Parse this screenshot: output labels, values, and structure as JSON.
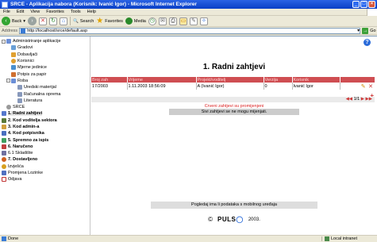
{
  "window": {
    "title": "SRCE - Aplikacija nabora (Korisnik: Ivanić Igor) - Microsoft Internet Explorer",
    "controls": {
      "minimize": "_",
      "maximize": "□",
      "close": "✕"
    }
  },
  "menu": [
    "File",
    "Edit",
    "View",
    "Favorites",
    "Tools",
    "Help"
  ],
  "toolbar": {
    "back": "Back",
    "search": "Search",
    "favorites": "Favorites",
    "media": "Media"
  },
  "address": {
    "label": "Address",
    "url": "http://localhost/srce/default.asp",
    "go": "Go"
  },
  "tree": [
    {
      "label": "Administriranje aplikacije",
      "level": 0,
      "expander": "−",
      "icon_color": "#6b8ed6"
    },
    {
      "label": "Gradovi",
      "level": 1,
      "icon_color": "#6aa0d8"
    },
    {
      "label": "Dobavljači",
      "level": 1,
      "icon_color": "#e0a030"
    },
    {
      "label": "Korisnici",
      "level": 1,
      "icon_color": "#e0a030"
    },
    {
      "label": "Mjerne jedinice",
      "level": 1,
      "icon_color": "#4a90d0"
    },
    {
      "label": "Potpis za papir",
      "level": 1,
      "icon_color": "#d07030"
    },
    {
      "label": "Roba",
      "level": 1,
      "expander": "−",
      "icon_color": "#6b8ed6"
    },
    {
      "label": "Uredski materijal",
      "level": 2,
      "icon_color": "#8899bb"
    },
    {
      "label": "Računalna oprema",
      "level": 2,
      "icon_color": "#8899bb"
    },
    {
      "label": "Literatura",
      "level": 2,
      "icon_color": "#8899bb"
    },
    {
      "label": "SRCE",
      "level": 0,
      "icon_color": "#999999"
    },
    {
      "label": "1. Radni zahtjevi",
      "level": 0,
      "bold": true,
      "selected": true,
      "icon_color": "#5577cc"
    },
    {
      "label": "2. Kod voditelja sektora",
      "level": 0,
      "bold": true,
      "icon_color": "#5a7a3a"
    },
    {
      "label": "3. Kod admin-a",
      "level": 0,
      "bold": true,
      "icon_color": "#d0a040"
    },
    {
      "label": "4. Kod potpisnika",
      "level": 0,
      "bold": true,
      "icon_color": "#4a70c0"
    },
    {
      "label": "5. Spremno za ispis",
      "level": 0,
      "bold": true,
      "icon_color": "#40a060"
    },
    {
      "label": "6. Naručeno",
      "level": 0,
      "bold": true,
      "icon_color": "#c04040"
    },
    {
      "label": "6.1 Skladište",
      "level": 0,
      "icon_color": "#7070a0"
    },
    {
      "label": "7. Dostavljeno",
      "level": 0,
      "bold": true,
      "icon_color": "#d06020"
    },
    {
      "label": "Izvješća",
      "level": 0,
      "icon_color": "#d8a020"
    },
    {
      "label": "Promjena Lozinke",
      "level": 0,
      "icon_color": "#5070c0"
    },
    {
      "label": "Odjava",
      "level": 0,
      "icon_color": "#c03030"
    }
  ],
  "main": {
    "help_icon": "?",
    "title": "1. Radni zahtjevi",
    "table": {
      "columns": [
        "Broj zah",
        "Vrijeme",
        "Projekt/voditelj",
        "Verzija",
        "Korisnik"
      ],
      "rows": [
        [
          "17/2003",
          "1.11.2003 18:56:09",
          "A (Ivanić Igor)",
          "0",
          "Ivanić Igor"
        ]
      ]
    },
    "pager": {
      "first": "◀◀",
      "info": "1/1",
      "next": "▶",
      "last": "▶▶"
    },
    "message_changes": "Crveni zahtjevi su promijenjeni",
    "message_locked": "Sivi zahtjevi se ne mogu mijenjati.",
    "mobile_link": "Pogledaj ima li podataka s mobilnog uređaja",
    "footer": {
      "copyright": "©",
      "brand": "PULS",
      "year": "2003."
    }
  },
  "status": {
    "left": "Done",
    "zone": "Local intranet"
  },
  "colors": {
    "titlebar": "#0a3fc6",
    "grid_header": "#cf4e52",
    "message_red": "#d22222",
    "locked_bg": "#cccccc"
  }
}
